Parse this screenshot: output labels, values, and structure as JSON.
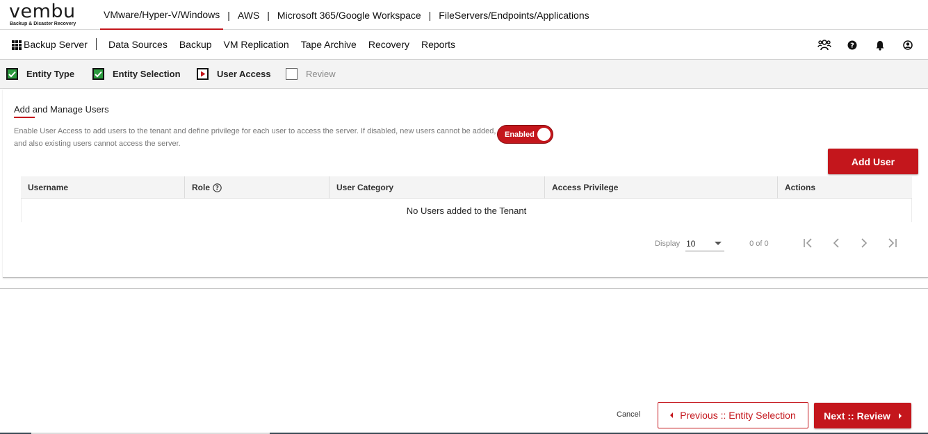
{
  "brand": {
    "name": "vembu",
    "tagline": "Backup & Disaster Recovery",
    "accent": "#c4161c"
  },
  "top_nav": [
    {
      "label": "VMware/Hyper-V/Windows",
      "active": true
    },
    {
      "label": "AWS",
      "active": false
    },
    {
      "label": "Microsoft 365/Google Workspace",
      "active": false
    },
    {
      "label": "FileServers/Endpoints/Applications",
      "active": false
    }
  ],
  "header": {
    "app_label": "Backup Server",
    "menu": [
      "Data Sources",
      "Backup",
      "VM Replication",
      "Tape Archive",
      "Recovery",
      "Reports"
    ],
    "icons": [
      "users-group-icon",
      "help-icon",
      "bell-icon",
      "user-icon"
    ]
  },
  "steps": [
    {
      "label": "Entity Type",
      "state": "done"
    },
    {
      "label": "Entity Selection",
      "state": "done"
    },
    {
      "label": "User Access",
      "state": "current"
    },
    {
      "label": "Review",
      "state": "pending"
    }
  ],
  "section": {
    "title": "Add and Manage Users",
    "description": "Enable User Access to add users to the tenant and define privilege for each user to access the server. If disabled, new users cannot be added, and also existing users cannot access the server.",
    "toggle_label": "Enabled",
    "toggle_on": true,
    "add_user_label": "Add User"
  },
  "table": {
    "columns": [
      "Username",
      "Role",
      "User Category",
      "Access Privilege",
      "Actions"
    ],
    "empty_message": "No Users added to the Tenant"
  },
  "pager": {
    "display_label": "Display",
    "page_size": "10",
    "count_text": "0 of 0"
  },
  "footer": {
    "cancel_label": "Cancel",
    "prev_label": "Previous :: Entity Selection",
    "next_label": "Next :: Review"
  }
}
